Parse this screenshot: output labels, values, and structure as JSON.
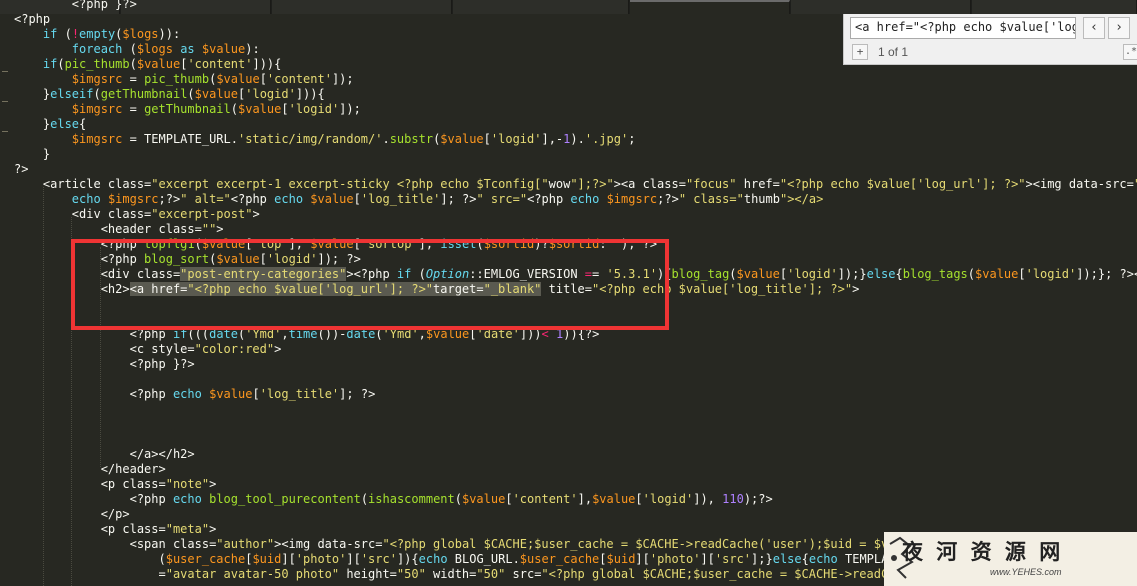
{
  "tabs": [
    {
      "label": ""
    },
    {
      "label": ""
    },
    {
      "label": ""
    },
    {
      "label": ""
    },
    {
      "label": ""
    },
    {
      "label": ""
    },
    {
      "label": ""
    }
  ],
  "code_lines": [
    "        <?php }?>",
    "<?php",
    "    if (!empty($logs)):",
    "        foreach ($logs as $value):",
    "    if(pic_thumb($value['content'])){",
    "        $imgsrc = pic_thumb($value['content']);",
    "    }elseif(getThumbnail($value['logid'])){",
    "        $imgsrc = getThumbnail($value['logid']);",
    "    }else{",
    "        $imgsrc = TEMPLATE_URL.'static/img/random/'.substr($value['logid'],-1).'.jpg';",
    "    }",
    "?>",
    "    <article class=\"excerpt excerpt-1 excerpt-sticky <?php echo $Tconfig[\"wow\"];?>\"><a class=\"focus\" href=\"<?php echo $value['log_url']; ?>\"><img data-src=\"<",
    "        echo $imgsrc;?>\" alt=\"<?php echo $value['log_title']; ?>\" src=\"<?php echo $imgsrc;?>\" class=\"thumb\"></a>",
    "        <div class=\"excerpt-post\">",
    "            <header class=\"\">",
    "            <?php topflg1($value['top'], $value['sortop'], isset($sortid)?$sortid:''); ?>",
    "            <?php blog_sort($value['logid']); ?>",
    "            <div class=\"post-entry-categories\"><?php if (Option::EMLOG_VERSION == '5.3.1'){blog_tag($value['logid']);}else{blog_tags($value['logid']);}; ?></",
    "            <h2><a href=\"<?php echo $value['log_url']; ?>\"target=\"_blank\" title=\"<?php echo $value['log_title']; ?>\">",
    "",
    "",
    "                <?php if(((date('Ymd',time())-date('Ymd',$value['date']))< 1)){?>",
    "                <c style=\"color:red\">",
    "                <?php }?>",
    "",
    "                <?php echo $value['log_title']; ?>",
    "",
    "",
    "",
    "                </a></h2>",
    "            </header>",
    "            <p class=\"note\">",
    "                <?php echo blog_tool_purecontent(ishascomment($value['content'],$value['logid']), 110);?>",
    "            </p>",
    "            <p class=\"meta\">",
    "                <span class=\"author\"><img data-src=\"<?php global $CACHE;$user_cache = $CACHE->readCache('user');$uid = $value['author'];if(",
    "                    ($user_cache[$uid]['photo']['src']){echo BLOG_URL.$user_cache[$uid]['photo']['src'];}else{echo TEMPLATE_URL.'static/img/avatar.png';}?",
    "                    =\"avatar avatar-50 photo\" height=\"50\" width=\"50\" src=\"<?php global $CACHE;$user_cache = $CACHE->readCache('user');$uid = $value['"
  ],
  "find": {
    "query": "<a href=\"<?php echo $value['log",
    "count": "1 of 1",
    "prev_icon": "chevron-left-icon",
    "next_icon": "chevron-right-icon",
    "add": "+",
    "regex": ".*"
  },
  "watermark": {
    "title": "夜 河 资 源 网",
    "url": "www.YEHES.com"
  }
}
